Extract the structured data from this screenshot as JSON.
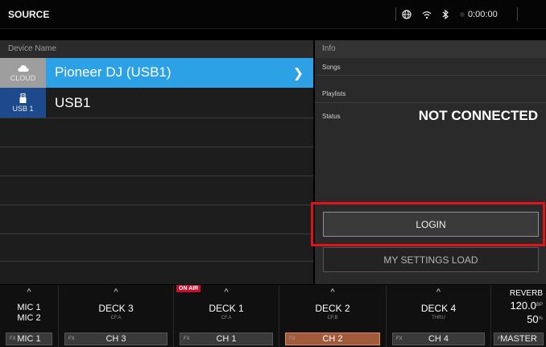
{
  "topbar": {
    "title": "SOURCE",
    "time": "0:00:00"
  },
  "list": {
    "header": "Device Name",
    "rows": [
      {
        "icon_label": "CLOUD",
        "icon": "cloud-icon",
        "name": "Pioneer DJ (USB1)",
        "selected": true
      },
      {
        "icon_label": "USB 1",
        "icon": "usb-icon",
        "name": "USB1",
        "selected": false
      }
    ]
  },
  "info": {
    "header": "Info",
    "songs_label": "Songs",
    "playlists_label": "Playlists",
    "status_label": "Status",
    "status_value": "NOT CONNECTED",
    "login_label": "LOGIN",
    "mysettings_label": "MY SETTINGS LOAD"
  },
  "mixer": {
    "onair": "ON AIR",
    "mic": {
      "line1": "MIC 1",
      "line2": "MIC 2",
      "ch": "MIC 1"
    },
    "deck3": {
      "main": "DECK 3",
      "sub": "CF.A",
      "ch": "CH 3"
    },
    "deck1": {
      "main": "DECK 1",
      "sub": "CF.A",
      "ch": "CH 1"
    },
    "deck2": {
      "main": "DECK 2",
      "sub": "CF.B",
      "ch": "CH 2"
    },
    "deck4": {
      "main": "DECK 4",
      "sub": "THRU",
      "ch": "CH 4"
    },
    "fx": {
      "name": "REVERB",
      "bpm": "120.0",
      "bpm_unit": "BP",
      "depth": "50",
      "depth_unit": "%",
      "ch": "MASTER"
    },
    "fx_tag": "FX"
  },
  "colors": {
    "selected_row": "#2da1e6",
    "highlight": "#e3121a",
    "onair": "#c8102e",
    "active_ch": "#a05a3c"
  }
}
